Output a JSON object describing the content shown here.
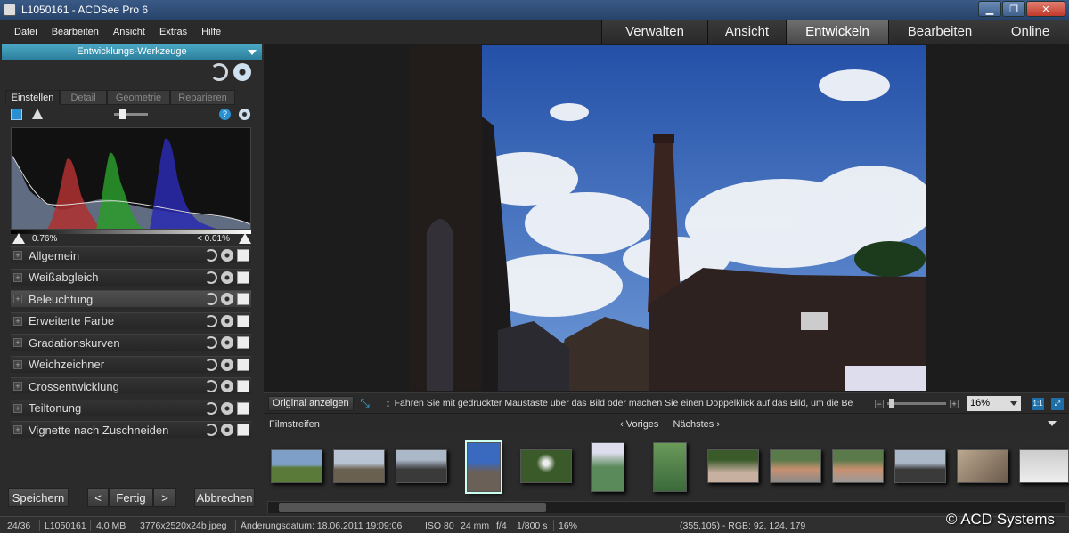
{
  "window": {
    "title": "L1050161 - ACDSee Pro 6"
  },
  "menu": [
    "Datei",
    "Bearbeiten",
    "Ansicht",
    "Extras",
    "Hilfe"
  ],
  "modes": [
    "Verwalten",
    "Ansicht",
    "Entwickeln",
    "Bearbeiten",
    "Online"
  ],
  "active_mode": "Entwickeln",
  "left_panel": {
    "header": "Entwicklungs-Werkzeuge",
    "tabs": [
      "Einstellen",
      "Detail",
      "Geometrie",
      "Reparieren"
    ],
    "active_tab": "Einstellen",
    "clip_low": "0.76%",
    "clip_high": "< 0.01%",
    "sections": [
      "Allgemein",
      "Weißabgleich",
      "Beleuchtung",
      "Erweiterte Farbe",
      "Gradationskurven",
      "Weichzeichner",
      "Crossentwicklung",
      "Teiltonung",
      "Vignette nach Zuschneiden"
    ],
    "active_section": "Beleuchtung",
    "buttons": {
      "save": "Speichern",
      "prev": "<",
      "done": "Fertig",
      "next": ">",
      "cancel": "Abbrechen"
    }
  },
  "image_toolbar": {
    "original_button": "Original anzeigen",
    "hint": "Fahren Sie mit gedrückter Maustaste über das Bild oder machen Sie einen Doppelklick auf das Bild, um die Be...",
    "zoom": "16%",
    "one_to_one": "1:1"
  },
  "filmstrip": {
    "title": "Filmstreifen",
    "prev": "Voriges",
    "next": "Nächstes"
  },
  "statusbar": {
    "index": "24/36",
    "filename": "L1050161",
    "size": "4,0 MB",
    "dimensions": "3776x2520x24b jpeg",
    "modified": "Änderungsdatum: 18.06.2011 19:09:06",
    "iso": "ISO 80",
    "focal": "24 mm",
    "aperture": "f/4",
    "shutter": "1/800 s",
    "zoom": "16%",
    "pixel": "(355,105) - RGB: 92, 124, 179"
  },
  "watermark": "© ACD Systems",
  "colors": {
    "accent": "#2c8fb0",
    "active_tab": "#5a5a5a",
    "background": "#1c1c1c"
  }
}
